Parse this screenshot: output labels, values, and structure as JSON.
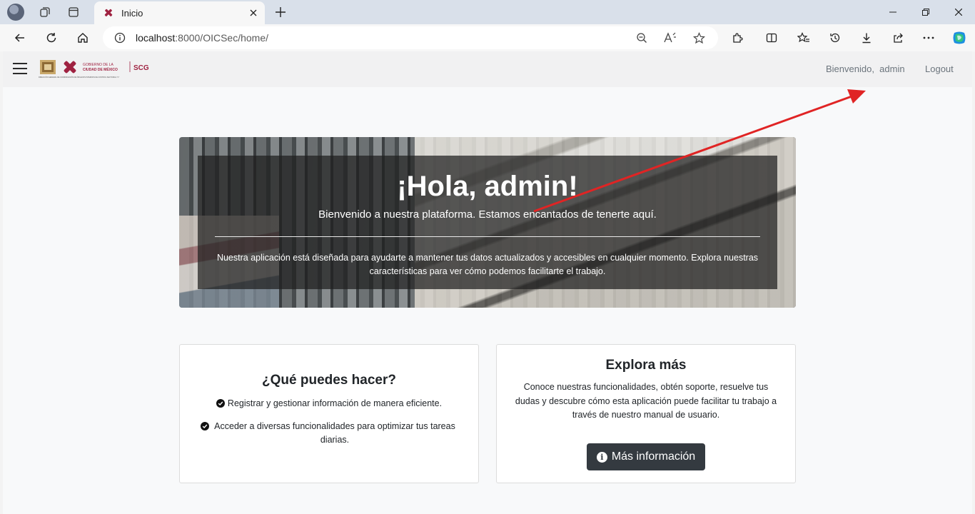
{
  "browser": {
    "tab_title": "Inicio",
    "url_host": "localhost",
    "url_path": ":8000/OICSec/home/"
  },
  "navbar": {
    "logo_lines": [
      "GOBIERNO DE LA",
      "CIUDAD DE MÉXICO",
      "SCG"
    ],
    "logo_caption": "DIRECCIÓN GENERAL DE COORDINACIÓN DE ÓRGANOS INTERNOS DE CONTROL SECTORIAL \"C\"",
    "welcome": "Bienvenido,  admin",
    "logout": "Logout"
  },
  "hero": {
    "title": "¡Hola, admin!",
    "subtitle": "Bienvenido a nuestra plataforma. Estamos encantados de tenerte aquí.",
    "text": "Nuestra aplicación está diseñada para ayudarte a mantener tus datos actualizados y accesibles en cualquier momento. Explora nuestras características para ver cómo podemos facilitarte el trabajo."
  },
  "card_left": {
    "title": "¿Qué puedes hacer?",
    "features": [
      "Registrar y gestionar información de manera eficiente.",
      "Acceder a diversas funcionalidades para optimizar tus tareas diarias."
    ]
  },
  "card_right": {
    "title": "Explora más",
    "description": "Conoce nuestras funcionalidades, obtén soporte, resuelve tus dudas y descubre cómo esta aplicación puede facilitar tu trabajo a través de nuestro manual de usuario.",
    "button": "Más información"
  },
  "colors": {
    "annotation_arrow": "#e02424",
    "brand": "#9f2241",
    "dark_button": "#343a40"
  }
}
